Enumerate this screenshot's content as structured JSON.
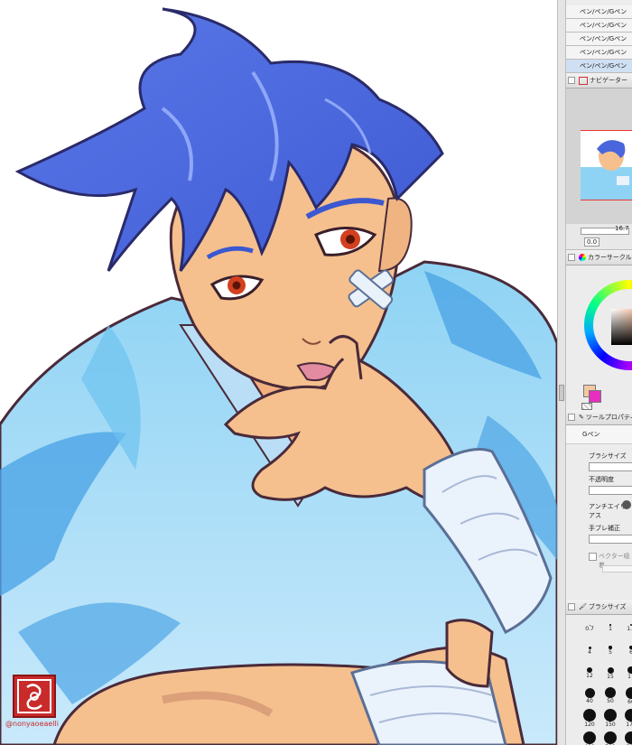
{
  "artwork": {
    "signature": "@nonyaoeaelli"
  },
  "panel": {
    "layer_rows": [
      {
        "label": "ペン/ペン/Gペン",
        "selected": false
      },
      {
        "label": "ペン/ペン/Gペン",
        "selected": false
      },
      {
        "label": "ペン/ペン/Gペン",
        "selected": false
      },
      {
        "label": "ペン/ペン/Gペン",
        "selected": false
      },
      {
        "label": "ペン/ペン/Gペン",
        "selected": true
      }
    ],
    "navigator_title": "ナビゲーター",
    "zoom_value": "16.7",
    "rotate_value": "0.0",
    "color_title": "カラーサークル",
    "tool_title": "ツールプロパティ",
    "tool_name": "Gペン",
    "brush_size_label": "ブラシサイズ",
    "opacity_label": "不透明度",
    "antialias_label": "アンチエイリアス",
    "stabilization_label": "手ブレ補正",
    "vector_label": "ベクター吸着",
    "brush_size_title": "ブラシサイズ",
    "brush_sizes": [
      "0.7",
      "1",
      "1.5",
      "4",
      "5",
      "6",
      "12",
      "15",
      "17",
      "40",
      "50",
      "60",
      "120",
      "150",
      "170",
      "400",
      "500",
      "600"
    ],
    "colors": {
      "main": "#f2c9a2",
      "sub": "#e52fbf",
      "accent": "#4a7fe0"
    }
  }
}
